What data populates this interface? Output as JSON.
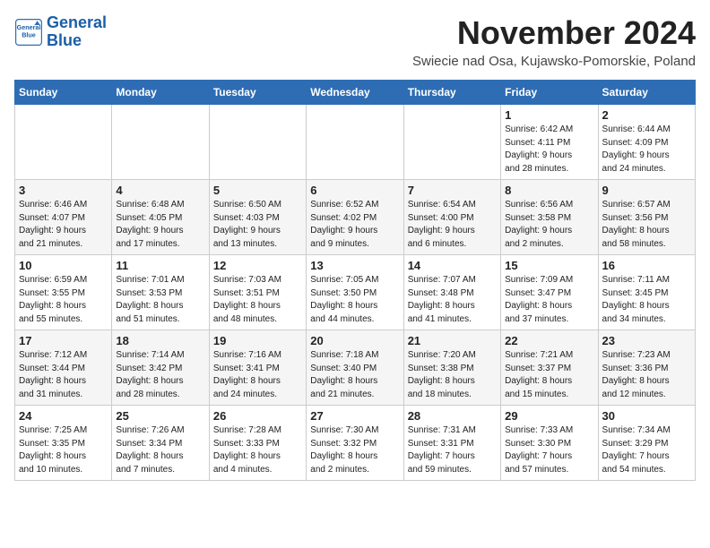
{
  "header": {
    "logo_line1": "General",
    "logo_line2": "Blue",
    "title": "November 2024",
    "subtitle": "Swiecie nad Osa, Kujawsko-Pomorskie, Poland"
  },
  "days_of_week": [
    "Sunday",
    "Monday",
    "Tuesday",
    "Wednesday",
    "Thursday",
    "Friday",
    "Saturday"
  ],
  "weeks": [
    [
      {
        "day": "",
        "info": ""
      },
      {
        "day": "",
        "info": ""
      },
      {
        "day": "",
        "info": ""
      },
      {
        "day": "",
        "info": ""
      },
      {
        "day": "",
        "info": ""
      },
      {
        "day": "1",
        "info": "Sunrise: 6:42 AM\nSunset: 4:11 PM\nDaylight: 9 hours\nand 28 minutes."
      },
      {
        "day": "2",
        "info": "Sunrise: 6:44 AM\nSunset: 4:09 PM\nDaylight: 9 hours\nand 24 minutes."
      }
    ],
    [
      {
        "day": "3",
        "info": "Sunrise: 6:46 AM\nSunset: 4:07 PM\nDaylight: 9 hours\nand 21 minutes."
      },
      {
        "day": "4",
        "info": "Sunrise: 6:48 AM\nSunset: 4:05 PM\nDaylight: 9 hours\nand 17 minutes."
      },
      {
        "day": "5",
        "info": "Sunrise: 6:50 AM\nSunset: 4:03 PM\nDaylight: 9 hours\nand 13 minutes."
      },
      {
        "day": "6",
        "info": "Sunrise: 6:52 AM\nSunset: 4:02 PM\nDaylight: 9 hours\nand 9 minutes."
      },
      {
        "day": "7",
        "info": "Sunrise: 6:54 AM\nSunset: 4:00 PM\nDaylight: 9 hours\nand 6 minutes."
      },
      {
        "day": "8",
        "info": "Sunrise: 6:56 AM\nSunset: 3:58 PM\nDaylight: 9 hours\nand 2 minutes."
      },
      {
        "day": "9",
        "info": "Sunrise: 6:57 AM\nSunset: 3:56 PM\nDaylight: 8 hours\nand 58 minutes."
      }
    ],
    [
      {
        "day": "10",
        "info": "Sunrise: 6:59 AM\nSunset: 3:55 PM\nDaylight: 8 hours\nand 55 minutes."
      },
      {
        "day": "11",
        "info": "Sunrise: 7:01 AM\nSunset: 3:53 PM\nDaylight: 8 hours\nand 51 minutes."
      },
      {
        "day": "12",
        "info": "Sunrise: 7:03 AM\nSunset: 3:51 PM\nDaylight: 8 hours\nand 48 minutes."
      },
      {
        "day": "13",
        "info": "Sunrise: 7:05 AM\nSunset: 3:50 PM\nDaylight: 8 hours\nand 44 minutes."
      },
      {
        "day": "14",
        "info": "Sunrise: 7:07 AM\nSunset: 3:48 PM\nDaylight: 8 hours\nand 41 minutes."
      },
      {
        "day": "15",
        "info": "Sunrise: 7:09 AM\nSunset: 3:47 PM\nDaylight: 8 hours\nand 37 minutes."
      },
      {
        "day": "16",
        "info": "Sunrise: 7:11 AM\nSunset: 3:45 PM\nDaylight: 8 hours\nand 34 minutes."
      }
    ],
    [
      {
        "day": "17",
        "info": "Sunrise: 7:12 AM\nSunset: 3:44 PM\nDaylight: 8 hours\nand 31 minutes."
      },
      {
        "day": "18",
        "info": "Sunrise: 7:14 AM\nSunset: 3:42 PM\nDaylight: 8 hours\nand 28 minutes."
      },
      {
        "day": "19",
        "info": "Sunrise: 7:16 AM\nSunset: 3:41 PM\nDaylight: 8 hours\nand 24 minutes."
      },
      {
        "day": "20",
        "info": "Sunrise: 7:18 AM\nSunset: 3:40 PM\nDaylight: 8 hours\nand 21 minutes."
      },
      {
        "day": "21",
        "info": "Sunrise: 7:20 AM\nSunset: 3:38 PM\nDaylight: 8 hours\nand 18 minutes."
      },
      {
        "day": "22",
        "info": "Sunrise: 7:21 AM\nSunset: 3:37 PM\nDaylight: 8 hours\nand 15 minutes."
      },
      {
        "day": "23",
        "info": "Sunrise: 7:23 AM\nSunset: 3:36 PM\nDaylight: 8 hours\nand 12 minutes."
      }
    ],
    [
      {
        "day": "24",
        "info": "Sunrise: 7:25 AM\nSunset: 3:35 PM\nDaylight: 8 hours\nand 10 minutes."
      },
      {
        "day": "25",
        "info": "Sunrise: 7:26 AM\nSunset: 3:34 PM\nDaylight: 8 hours\nand 7 minutes."
      },
      {
        "day": "26",
        "info": "Sunrise: 7:28 AM\nSunset: 3:33 PM\nDaylight: 8 hours\nand 4 minutes."
      },
      {
        "day": "27",
        "info": "Sunrise: 7:30 AM\nSunset: 3:32 PM\nDaylight: 8 hours\nand 2 minutes."
      },
      {
        "day": "28",
        "info": "Sunrise: 7:31 AM\nSunset: 3:31 PM\nDaylight: 7 hours\nand 59 minutes."
      },
      {
        "day": "29",
        "info": "Sunrise: 7:33 AM\nSunset: 3:30 PM\nDaylight: 7 hours\nand 57 minutes."
      },
      {
        "day": "30",
        "info": "Sunrise: 7:34 AM\nSunset: 3:29 PM\nDaylight: 7 hours\nand 54 minutes."
      }
    ]
  ]
}
